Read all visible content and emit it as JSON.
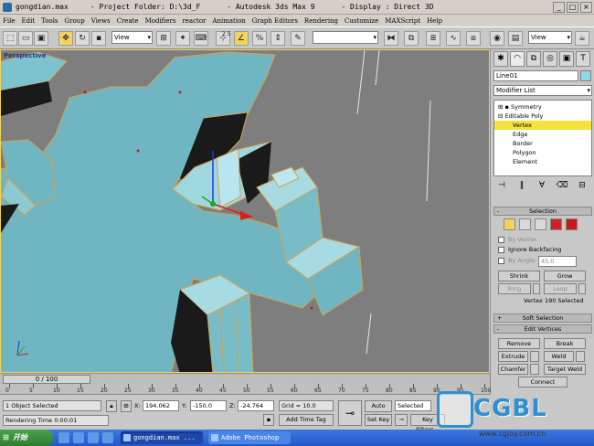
{
  "window": {
    "title": "gongdian.max     - Project Folder: D:\\3d_F      - Autodesk 3ds Max 9      - Display : Direct 3D"
  },
  "menu": [
    "File",
    "Edit",
    "Tools",
    "Group",
    "Views",
    "Create",
    "Modifiers",
    "reactor",
    "Animation",
    "Graph Editors",
    "Rendering",
    "Customize",
    "MAXScript",
    "Help"
  ],
  "toolbar": {
    "ref_coord": "View",
    "ref_coord2": "View",
    "selection_set": "",
    "snap_label": "2.5"
  },
  "viewport": {
    "label": "Perspective",
    "colors": {
      "ground": "#7e7e7e",
      "mesh": "#6fb6c2",
      "edge": "#d6a04a",
      "dark": "#1a1a1a",
      "highlight": "#f2d45a"
    }
  },
  "panel": {
    "object_name": "Line01",
    "modifier_list": "Modifier List",
    "stack": [
      {
        "label": "Symmetry",
        "level": 0
      },
      {
        "label": "Editable Poly",
        "level": 0
      },
      {
        "label": "Vertex",
        "level": 1,
        "selected": true
      },
      {
        "label": "Edge",
        "level": 1
      },
      {
        "label": "Border",
        "level": 1
      },
      {
        "label": "Polygon",
        "level": 1
      },
      {
        "label": "Element",
        "level": 1
      }
    ],
    "selection": {
      "title": "Selection",
      "by_vertex": "By Vertex",
      "ignore_backfacing": "Ignore Backfacing",
      "by_angle": "By Angle:",
      "angle_value": "45.0",
      "shrink": "Shrink",
      "grow": "Grow",
      "ring": "Ring",
      "loop": "Loop",
      "status": "Vertex 190 Selected"
    },
    "soft_selection": "Soft Selection",
    "edit_vertices": {
      "title": "Edit Vertices",
      "remove": "Remove",
      "break": "Break",
      "extrude": "Extrude",
      "weld": "Weld",
      "chamfer": "Chamfer",
      "target_weld": "Target Weld",
      "connect": "Connect"
    }
  },
  "timeline": {
    "slider": "0 / 100",
    "ticks": [
      "0",
      "5",
      "10",
      "15",
      "20",
      "25",
      "30",
      "35",
      "40",
      "45",
      "50",
      "55",
      "60",
      "65",
      "70",
      "75",
      "80",
      "85",
      "90",
      "95",
      "100"
    ]
  },
  "status": {
    "selected": "1 Object Selected",
    "x_label": "X:",
    "x": "194.062",
    "y_label": "Y:",
    "y": "-150.0",
    "z_label": "Z:",
    "z": "-24.764",
    "grid": "Grid = 10.0",
    "auto_key": "Auto Key",
    "key_mode": "Selected",
    "set_key": "Set Key",
    "key_filters": "Key Filters...",
    "rendering": "Rendering Time  0:00:01",
    "add_time_tag": "Add Time Tag"
  },
  "taskbar": {
    "start": "开始",
    "tasks": [
      {
        "label": "gongdian.max ...",
        "active": true
      },
      {
        "label": "Adobe Photoshop",
        "active": false
      }
    ]
  },
  "watermark": {
    "brand": "CGBL",
    "url": "www.cgjoy.com.cn"
  }
}
